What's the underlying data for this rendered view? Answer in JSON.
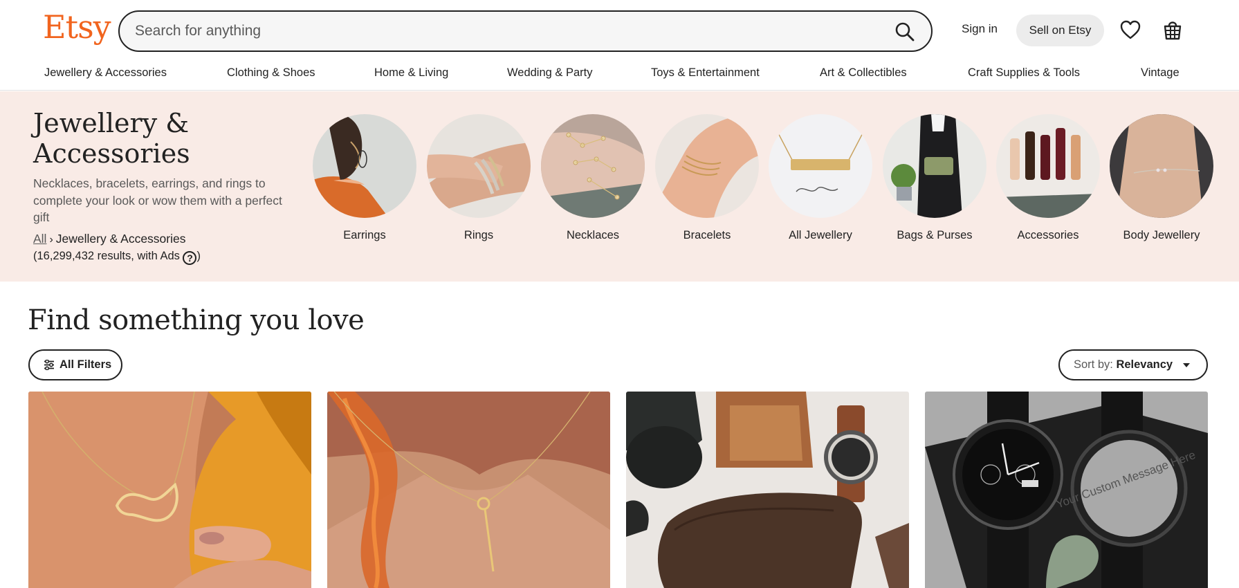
{
  "header": {
    "logo": "Etsy",
    "search_placeholder": "Search for anything",
    "sign_in": "Sign in",
    "sell": "Sell on Etsy"
  },
  "nav": [
    "Jewellery & Accessories",
    "Clothing & Shoes",
    "Home & Living",
    "Wedding & Party",
    "Toys & Entertainment",
    "Art & Collectibles",
    "Craft Supplies & Tools",
    "Vintage"
  ],
  "hero": {
    "title": "Jewellery & Accessories",
    "description": "Necklaces, bracelets, earrings, and rings to complete your look or wow them with a perfect gift",
    "crumb_all": "All",
    "crumb_current": "Jewellery & Accessories",
    "results_prefix": "(16,299,432 results, with Ads",
    "results_suffix": ")"
  },
  "categories": [
    "Earrings",
    "Rings",
    "Necklaces",
    "Bracelets",
    "All Jewellery",
    "Bags & Purses",
    "Accessories",
    "Body Jewellery"
  ],
  "section": {
    "title": "Find something you love",
    "all_filters": "All Filters",
    "sort_label": "Sort by:",
    "sort_value": "Relevancy"
  },
  "listings": {
    "card4_text": "Your Custom Message Here"
  },
  "colors": {
    "brand": "#f1641e",
    "hero_bg": "#f9ebe6"
  }
}
